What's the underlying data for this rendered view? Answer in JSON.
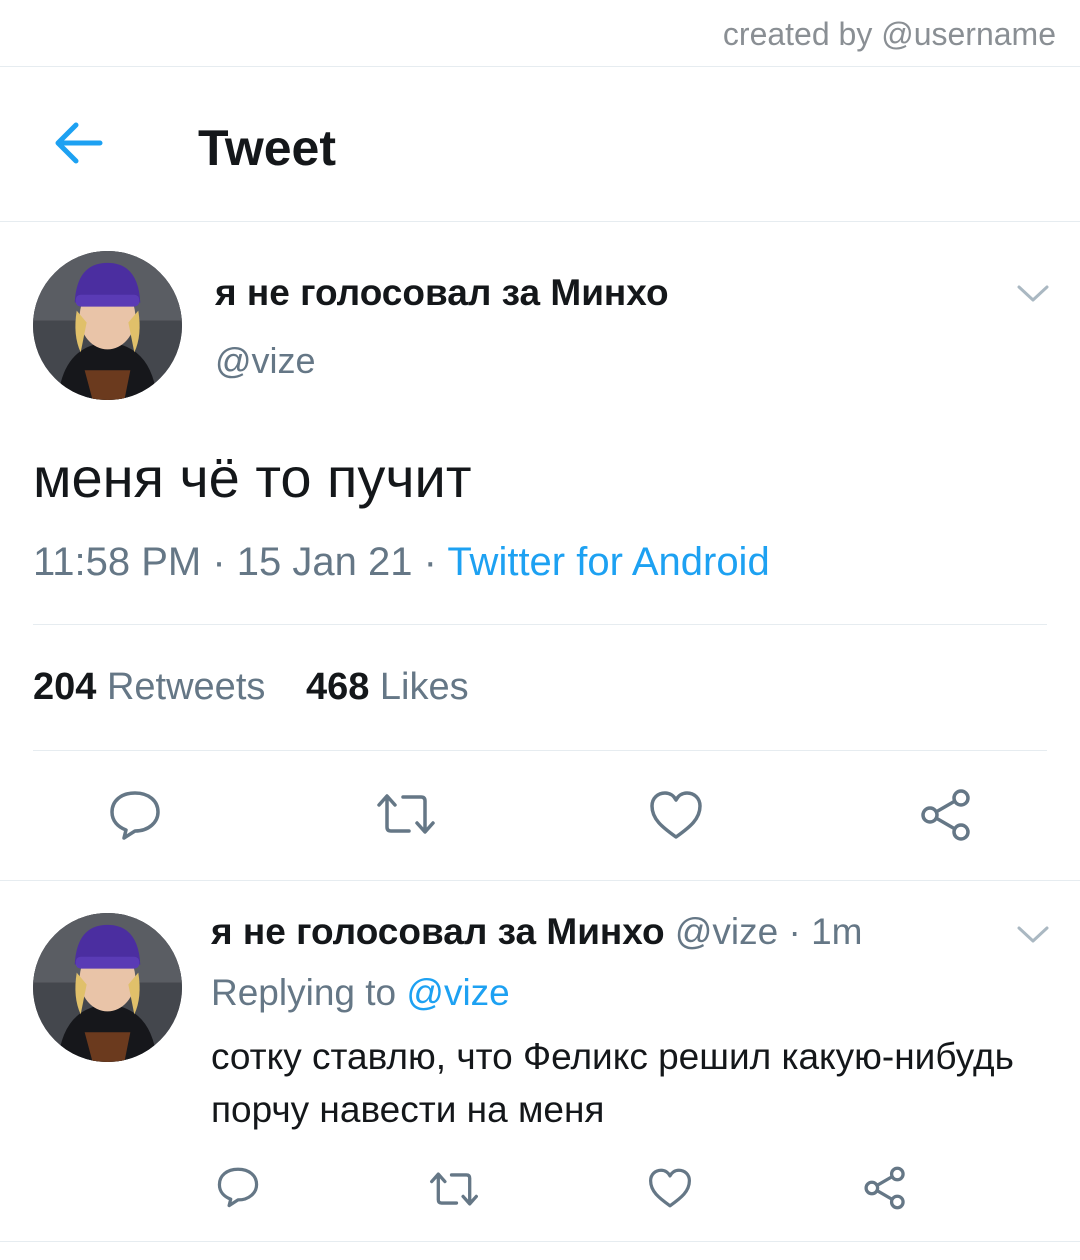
{
  "credit": "created by @username",
  "header": {
    "title": "Tweet"
  },
  "tweet": {
    "display_name": "я не голосовал за Минхо",
    "handle": "@vize",
    "text": "меня чё то пучит",
    "time": "11:58 PM",
    "date": "15 Jan 21",
    "separator": " · ",
    "source": "Twitter for Android",
    "retweets_count": "204",
    "retweets_label": "Retweets",
    "likes_count": "468",
    "likes_label": "Likes"
  },
  "reply": {
    "display_name": "я не голосовал за Минхо",
    "handle": "@vize",
    "time": "1m",
    "replying_label": "Replying to",
    "replying_to": "@vize",
    "text": "сотку ставлю, что Феликс решил какую-нибудь порчу навести на меня"
  },
  "icons": {
    "back": "arrow-left-icon",
    "caret": "chevron-down-icon",
    "reply": "reply-icon",
    "retweet": "retweet-icon",
    "like": "heart-icon",
    "share": "share-icon"
  },
  "colors": {
    "accent": "#1da1f2",
    "text": "#14171a",
    "secondary": "#657786",
    "divider": "#e6ecf0",
    "icon": "#657786"
  }
}
